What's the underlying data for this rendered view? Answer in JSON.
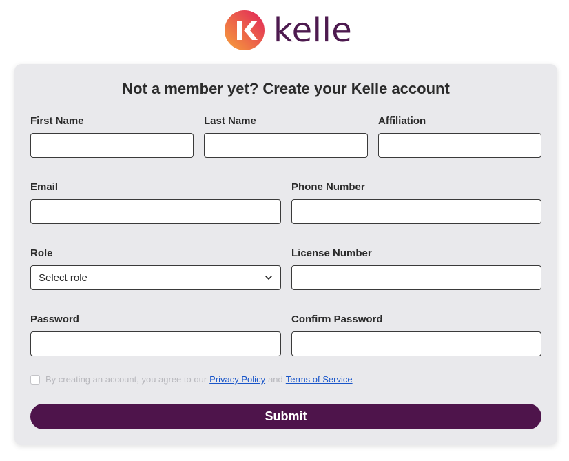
{
  "brand": {
    "name": "kelle",
    "colors": {
      "primary": "#4e144b",
      "gradient_start": "#f7a33a",
      "gradient_end": "#e0225a"
    }
  },
  "form": {
    "title": "Not a member yet? Create your Kelle account",
    "fields": {
      "first_name": {
        "label": "First Name",
        "value": ""
      },
      "last_name": {
        "label": "Last Name",
        "value": ""
      },
      "affiliation": {
        "label": "Affiliation",
        "value": ""
      },
      "email": {
        "label": "Email",
        "value": ""
      },
      "phone": {
        "label": "Phone Number",
        "value": ""
      },
      "role": {
        "label": "Role",
        "selected": "Select role"
      },
      "license": {
        "label": "License Number",
        "value": ""
      },
      "password": {
        "label": "Password",
        "value": ""
      },
      "confirm_password": {
        "label": "Confirm Password",
        "value": ""
      }
    },
    "consent": {
      "checked": false,
      "prefix": "By creating an account, you agree to our",
      "privacy_link": "Privacy Policy",
      "and": "and",
      "terms_link": "Terms of Service"
    },
    "submit_label": "Submit"
  }
}
